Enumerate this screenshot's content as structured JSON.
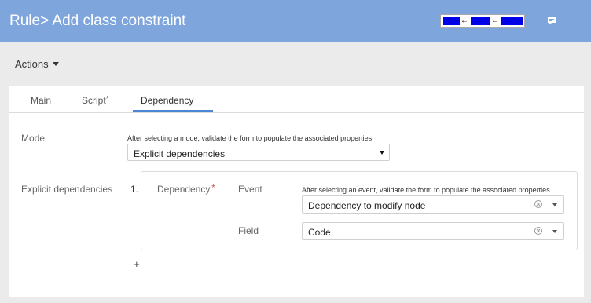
{
  "header": {
    "title": "Rule> Add class constraint",
    "comment_icon": "comment-icon"
  },
  "actions": {
    "label": "Actions"
  },
  "tabs": [
    {
      "label": "Main",
      "required": false,
      "active": false
    },
    {
      "label": "Script",
      "required": true,
      "active": false
    },
    {
      "label": "Dependency",
      "required": false,
      "active": true
    }
  ],
  "mode": {
    "label": "Mode",
    "help": "After selecting a mode, validate the form to populate the associated properties",
    "value": "Explicit dependencies"
  },
  "explicit_dependencies": {
    "label": "Explicit dependencies",
    "items": [
      {
        "index": "1.",
        "label": "Dependency",
        "required_mark": "*",
        "event_label": "Event",
        "event_help": "After selecting an event, validate the form to populate the associated properties",
        "event_value": "Dependency to modify node",
        "field_label": "Field",
        "field_value": "Code"
      }
    ],
    "add_label": "+"
  },
  "colors": {
    "header_bg": "#7ea6dd",
    "tab_active": "#4a88d6",
    "required": "#c0392b"
  }
}
